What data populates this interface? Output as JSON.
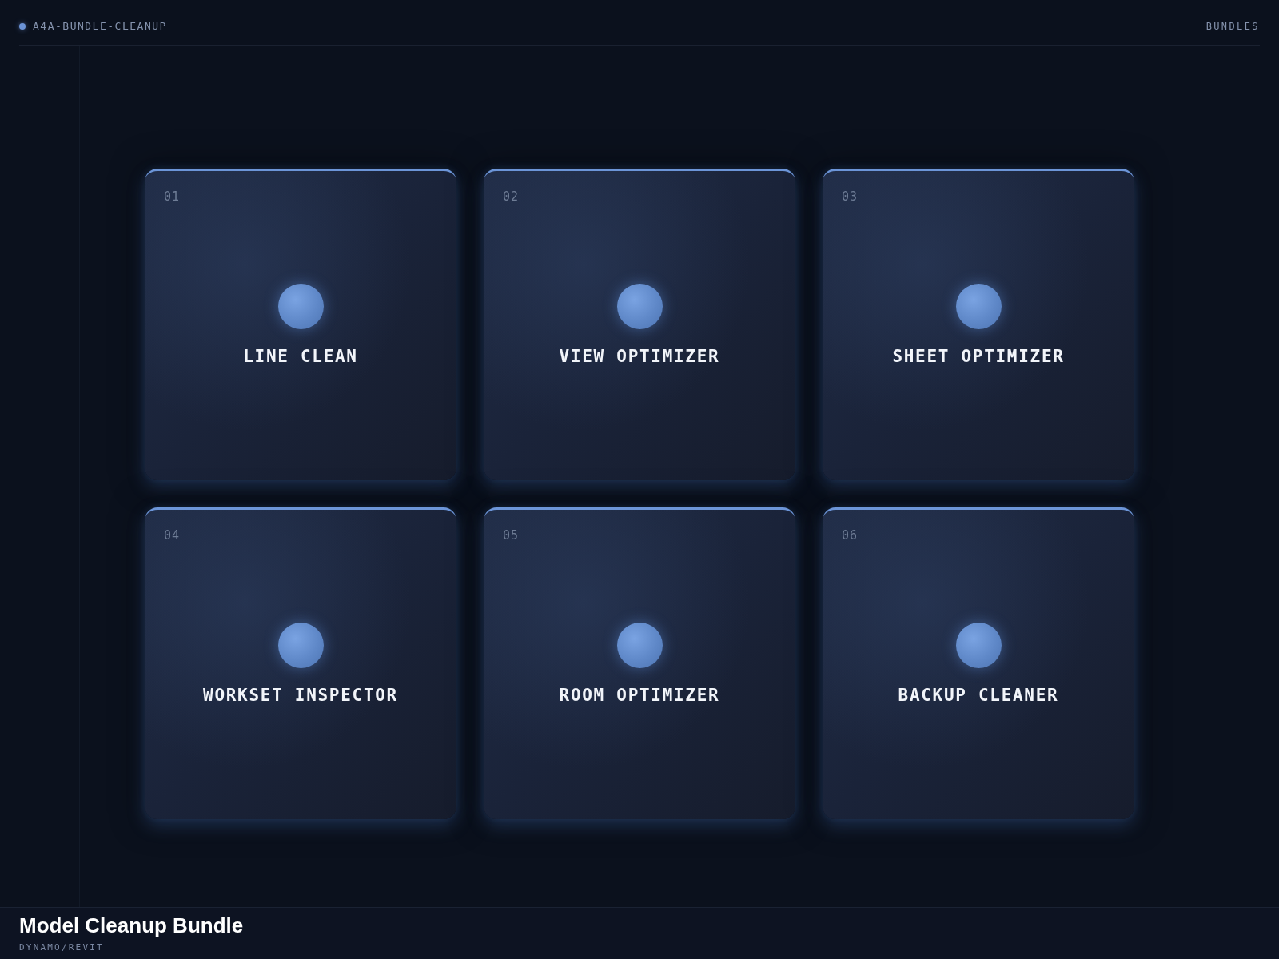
{
  "header": {
    "brand": "A4A-BUNDLE-CLEANUP",
    "nav_link": "BUNDLES"
  },
  "cards": [
    {
      "number": "01",
      "title": "LINE CLEAN"
    },
    {
      "number": "02",
      "title": "VIEW OPTIMIZER"
    },
    {
      "number": "03",
      "title": "SHEET OPTIMIZER"
    },
    {
      "number": "04",
      "title": "WORKSET INSPECTOR"
    },
    {
      "number": "05",
      "title": "ROOM OPTIMIZER"
    },
    {
      "number": "06",
      "title": "BACKUP CLEANER"
    }
  ],
  "footer": {
    "title": "Model Cleanup Bundle",
    "subtitle": "DYNAMO/REVIT"
  }
}
